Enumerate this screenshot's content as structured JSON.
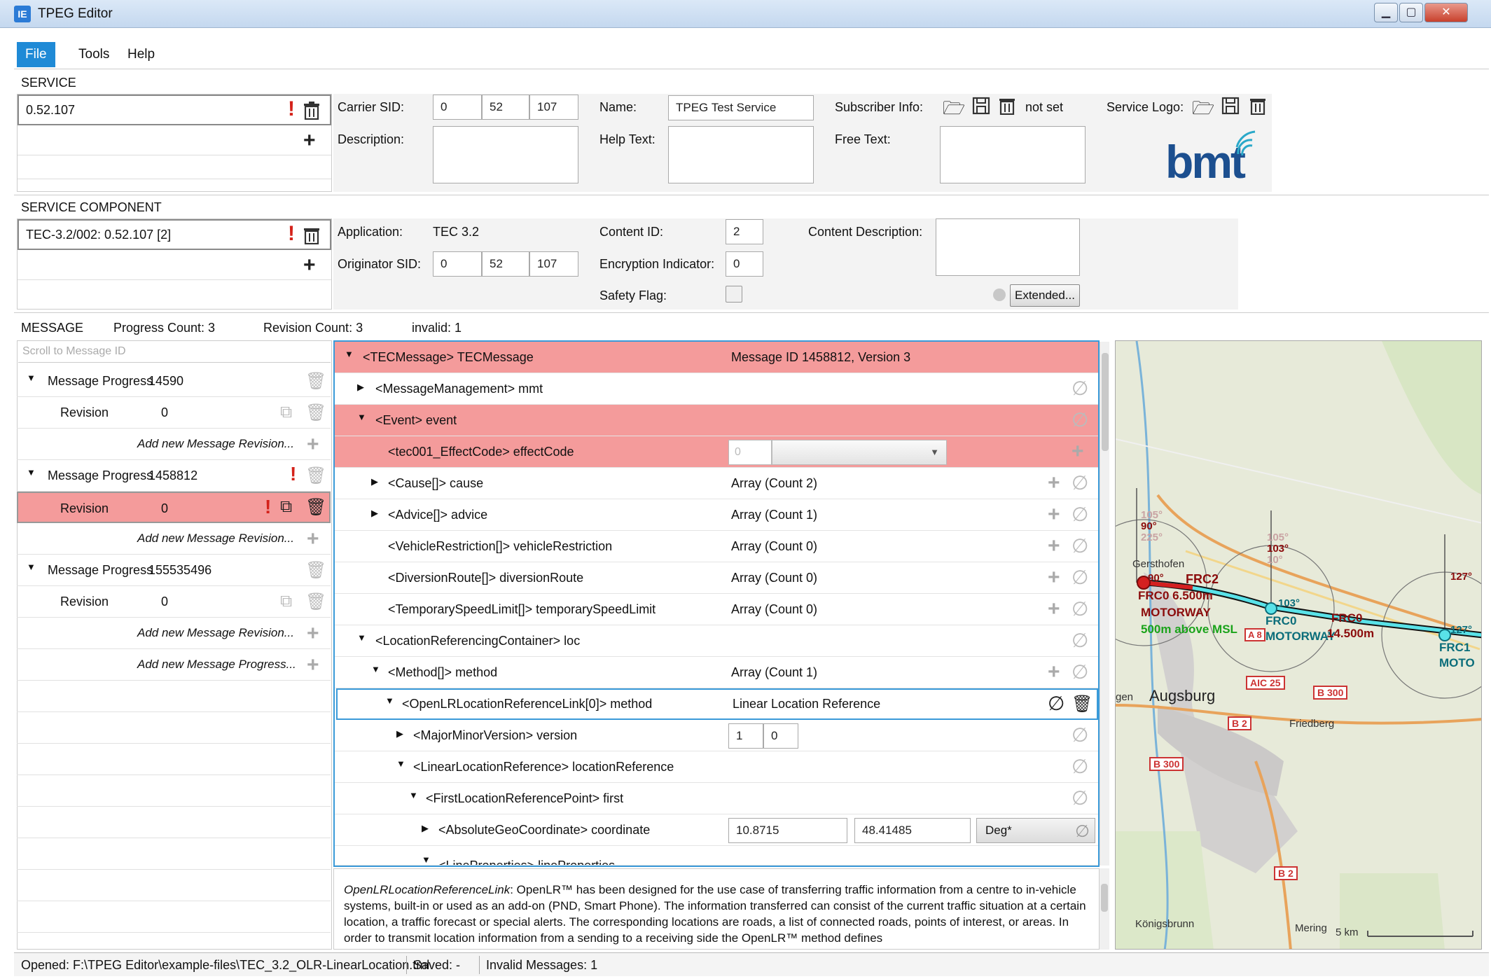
{
  "window": {
    "title": "TPEG Editor",
    "app_icon_glyph": "IE"
  },
  "menu": {
    "file": "File",
    "tools": "Tools",
    "help": "Help"
  },
  "service": {
    "header": "SERVICE",
    "list_item": "0.52.107",
    "carrier_sid_label": "Carrier SID:",
    "carrier_sid": [
      "0",
      "52",
      "107"
    ],
    "name_label": "Name:",
    "name_value": "TPEG Test Service",
    "subscriber_label": "Subscriber Info:",
    "subscriber_value": "not set",
    "logo_label": "Service Logo:",
    "description_label": "Description:",
    "help_text_label": "Help Text:",
    "free_text_label": "Free Text:",
    "logo_text": "bmt"
  },
  "component": {
    "header": "SERVICE COMPONENT",
    "list_item": "TEC-3.2/002: 0.52.107 [2]",
    "application_label": "Application:",
    "application_value": "TEC 3.2",
    "originator_label": "Originator SID:",
    "originator_sid": [
      "0",
      "52",
      "107"
    ],
    "content_id_label": "Content ID:",
    "content_id": "2",
    "encryption_label": "Encryption Indicator:",
    "encryption": "0",
    "safety_label": "Safety Flag:",
    "content_desc_label": "Content Description:",
    "extended_button": "Extended..."
  },
  "message": {
    "header": "MESSAGE",
    "progress_count": "Progress Count: 3",
    "revision_count": "Revision Count: 3",
    "invalid": "invalid: 1",
    "scroll_placeholder": "Scroll to Message ID",
    "tree": [
      {
        "type": "progress",
        "label": "Message Progress",
        "value": "14590"
      },
      {
        "type": "revision",
        "label": "Revision",
        "value": "0"
      },
      {
        "type": "add",
        "label": "Add new Message Revision..."
      },
      {
        "type": "progress",
        "label": "Message Progress",
        "value": "1458812"
      },
      {
        "type": "revision",
        "label": "Revision",
        "value": "0"
      },
      {
        "type": "add",
        "label": "Add new Message Revision..."
      },
      {
        "type": "progress",
        "label": "Message Progress",
        "value": "155535496"
      },
      {
        "type": "revision",
        "label": "Revision",
        "value": "0"
      },
      {
        "type": "add",
        "label": "Add new Message Revision..."
      },
      {
        "type": "add",
        "label": "Add new Message Progress..."
      }
    ]
  },
  "detail_tree": [
    {
      "label": "<TECMessage> TECMessage",
      "value": "Message ID 1458812, Version 3"
    },
    {
      "label": "<MessageManagement> mmt",
      "value": ""
    },
    {
      "label": "<Event> event",
      "value": ""
    },
    {
      "label": "<tec001_EffectCode> effectCode",
      "value": "0"
    },
    {
      "label": "<Cause[]> cause",
      "value": "Array (Count 2)"
    },
    {
      "label": "<Advice[]> advice",
      "value": "Array (Count 1)"
    },
    {
      "label": "<VehicleRestriction[]> vehicleRestriction",
      "value": "Array (Count 0)"
    },
    {
      "label": "<DiversionRoute[]> diversionRoute",
      "value": "Array (Count 0)"
    },
    {
      "label": "<TemporarySpeedLimit[]> temporarySpeedLimit",
      "value": "Array (Count 0)"
    },
    {
      "label": "<LocationReferencingContainer> loc",
      "value": ""
    },
    {
      "label": "<Method[]> method",
      "value": "Array (Count 1)"
    },
    {
      "label": "<OpenLRLocationReferenceLink[0]> method",
      "value": "Linear Location Reference"
    },
    {
      "label": "<MajorMinorVersion> version",
      "value": ""
    },
    {
      "label": "<LinearLocationReference> locationReference",
      "value": ""
    },
    {
      "label": "<FirstLocationReferencePoint> first",
      "value": ""
    },
    {
      "label": "<AbsoluteGeoCoordinate> coordinate",
      "value": ""
    },
    {
      "label": "<LineProperties> lineProperties",
      "value": ""
    }
  ],
  "version_values": [
    "1",
    "0"
  ],
  "coordinate": {
    "lon": "10.8715",
    "lat": "48.41485",
    "unit": "Deg*"
  },
  "description": {
    "term": "OpenLRLocationReferenceLink",
    "text": ": OpenLR™ has been designed for the use case of transferring traffic information from a centre to in-vehicle systems, built-in or used as an add-on (PND, Smart Phone). The information transferred can consist of the current traffic situation at a certain location, a traffic forecast or special alerts. The corresponding locations are roads, a list of connected roads, points of interest, or areas. In order to transmit location information from a sending to a receiving side the OpenLR™ method defines"
  },
  "map": {
    "labels": {
      "gersthofen": "Gersthofen",
      "augsburg": "Augsburg",
      "friedberg": "Friedberg",
      "koenigsbrunn": "Königsbrunn",
      "mering": "Mering",
      "gen": "gen",
      "aic25": "AIC 25",
      "b300a": "B 300",
      "b300b": "B 300",
      "b2a": "B 2",
      "b2b": "B 2",
      "a8": "A 8",
      "scale": "5 km"
    },
    "overlays": {
      "p1_angle1": "105°",
      "p1_angle2": "90°",
      "p1_angle3": "225°",
      "p1_angle4": "90°",
      "p1_frc2": "FRC2",
      "p1_frc0": "FRC0 6.500m",
      "p1_motorway": "MOTORWAY",
      "p1_elev": "500m above MSL",
      "p2_angle1": "105°",
      "p2_angle2": "103°",
      "p2_angle3": "10°",
      "p2_angle4": "103°",
      "p2_frc0": "FRC0",
      "p2_motorway": "MOTORWAY",
      "p2_frc0b": "FRC0",
      "p2_dist": "14.500m",
      "p3_angle1": "127°",
      "p3_angle2": "127°",
      "p3_frc1": "FRC1",
      "p3_moto": "MOTO"
    }
  },
  "status": {
    "opened": "Opened:  F:\\TPEG Editor\\example-files\\TEC_3.2_OLR-LinearLocation.tml",
    "saved": "Saved:  -",
    "invalid": "Invalid Messages:  1"
  }
}
